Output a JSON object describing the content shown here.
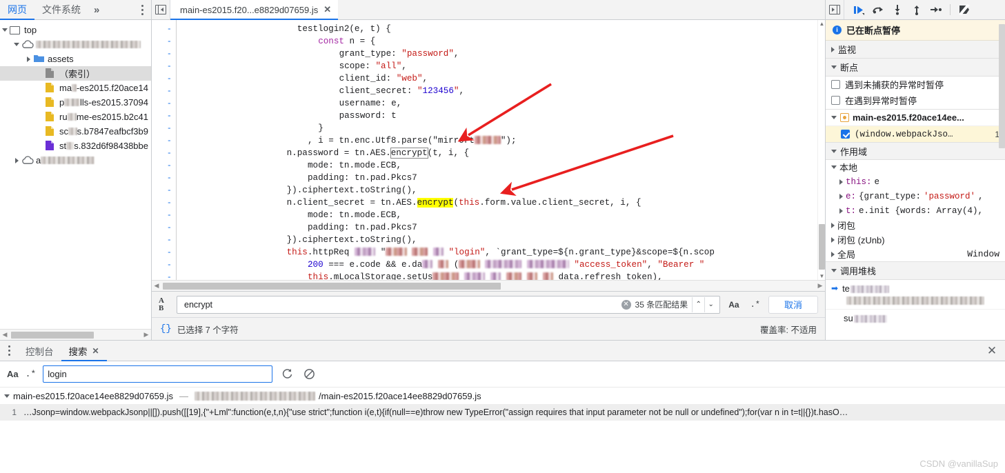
{
  "navigator": {
    "tabs": [
      {
        "label": "网页",
        "selected": true,
        "name": "tab-page"
      },
      {
        "label": "文件系统",
        "selected": false,
        "name": "tab-filesystem"
      }
    ],
    "more_label": "»",
    "tree": [
      {
        "depth": 0,
        "twisty": "open",
        "icon": "frame-icon",
        "label": "top",
        "redacted": false,
        "selected": false
      },
      {
        "depth": 1,
        "twisty": "open",
        "icon": "cloud-icon",
        "label": "",
        "redacted": true,
        "redact_width": 152,
        "selected": false
      },
      {
        "depth": 2,
        "twisty": "closed",
        "icon": "folder-icon",
        "label": "assets",
        "redacted": false,
        "selected": false
      },
      {
        "depth": 3,
        "twisty": "none",
        "icon": "doc-gray-icon",
        "label": "（索引）",
        "redacted": false,
        "selected": true
      },
      {
        "depth": 3,
        "twisty": "none",
        "icon": "doc-yellow-icon",
        "label": "ma",
        "label_tail": "-es2015.f20ace14",
        "redacted": true,
        "redact_width": 18,
        "selected": false
      },
      {
        "depth": 3,
        "twisty": "none",
        "icon": "doc-yellow-icon",
        "label": "p",
        "label_tail": "lls-es2015.37094",
        "redacted": true,
        "redact_width": 24,
        "selected": false
      },
      {
        "depth": 3,
        "twisty": "none",
        "icon": "doc-yellow-icon",
        "label": "ru",
        "label_tail": "me-es2015.b2c41",
        "redacted": true,
        "redact_width": 22,
        "selected": false
      },
      {
        "depth": 3,
        "twisty": "none",
        "icon": "doc-yellow-icon",
        "label": "sc",
        "label_tail": "s.b7847eafbcf3b9",
        "redacted": true,
        "redact_width": 22,
        "selected": false
      },
      {
        "depth": 3,
        "twisty": "none",
        "icon": "doc-purple-icon",
        "label": "st",
        "label_tail": "s.832d6f98438bbe",
        "redacted": true,
        "redact_width": 20,
        "selected": false
      },
      {
        "depth": 1,
        "twisty": "closed",
        "icon": "cloud-icon",
        "label": "a",
        "redacted": true,
        "redact_width": 78,
        "selected": false
      }
    ]
  },
  "editor": {
    "tab": {
      "title": "main-es2015.f20...e8829d07659.js",
      "close": "✕"
    },
    "gutter_marks": [
      "-",
      "-",
      "-",
      "-",
      "-",
      "-",
      "-",
      "-",
      "-",
      "-",
      "-",
      "-",
      "-",
      "-",
      "-",
      "-",
      "-",
      "-",
      "-",
      "-",
      "-"
    ],
    "code_lines": [
      "testlogin2(e, t) {",
      "const n = {",
      "grant_type: \"password\",",
      "scope: \"all\",",
      "client_id: \"web\",",
      "client_secret: \"123456\",",
      "username: e,",
      "password: t",
      "}",
      ", i = tn.enc.Utf8.parse(\"mirrort█████\");",
      "n.password = tn.AES.encrypt(t, i, {",
      "mode: tn.mode.ECB,",
      "padding: tn.pad.Pkcs7",
      "}).ciphertext.toString(),",
      "n.client_secret = tn.AES.encrypt(this.form.value.client_secret, i, {",
      "mode: tn.mode.ECB,",
      "padding: tn.pad.Pkcs7",
      "}).ciphertext.toString(),",
      "this.httpReq ████ \"████ ███ ██ \"login\", `grant_type=${n.grant_type}&scope=${n.scop",
      "200 === e.code && e.da██ ██ (████ ███████ ████████ \"access_token\", \"Bearer \"",
      "this.mLocalStorage.setUs█████ ████ ██ ███ ██ ██ data.refresh token),"
    ]
  },
  "findbar": {
    "case_icon_top": "A",
    "case_icon_bottom": "B",
    "query": "encrypt",
    "placeholder": "",
    "match_count": "35 条匹配结果",
    "prev_label": "⌃",
    "next_label": "⌄",
    "match_case_label": "Aa",
    "regex_label": ".*",
    "cancel_label": "取消"
  },
  "statusbar": {
    "pretty_print_icon": "{}",
    "selection_text": "已选择 7 个字符",
    "coverage_text": "覆盖率: 不适用"
  },
  "debugger": {
    "toolbar_icons": [
      "resume-icon",
      "step-over-icon",
      "step-into-icon",
      "step-out-icon",
      "step-icon",
      "deactivate-breakpoints-icon"
    ],
    "paused_banner": "已在断点暂停",
    "sections": {
      "watch": "监视",
      "breakpoints": "断点",
      "scope": "作用域",
      "callstack": "调用堆栈"
    },
    "breakpoint_options": [
      {
        "label": "遇到未捕获的异常时暂停",
        "checked": false
      },
      {
        "label": "在遇到异常时暂停",
        "checked": false
      }
    ],
    "breakpoint_file": "main-es2015.f20ace14ee...",
    "breakpoint_entry": {
      "label": "(window.webpackJso…",
      "line": "1",
      "checked": true
    },
    "scope_local_label": "本地",
    "scope_rows": [
      {
        "key": "this:",
        "val": " e",
        "mono": true
      },
      {
        "key": "e:",
        "val": " {grant_type: ",
        "str": "'password'",
        "tail": ",",
        "mono": true
      },
      {
        "key": "t:",
        "val": " e.init {words: Array(4),",
        "mono": true
      }
    ],
    "scope_groups": [
      {
        "label": "闭包",
        "right": ""
      },
      {
        "label": "闭包 (zUnb)",
        "right": ""
      },
      {
        "label": "全局",
        "right": "Window"
      }
    ],
    "callstack": [
      {
        "fn": "te",
        "fn_redacted": true,
        "file": "main-es2015.f20ace14ee8829d07659.js:1",
        "file_redacted": true,
        "active": true
      },
      {
        "fn": "sub",
        "fn_redacted": true,
        "file": "",
        "file_redacted": true,
        "active": false
      }
    ]
  },
  "drawer": {
    "tabs": [
      {
        "label": "控制台",
        "selected": false,
        "closable": false
      },
      {
        "label": "搜索",
        "selected": true,
        "closable": true,
        "close": "✕"
      }
    ],
    "close_label": "✕",
    "toolbar": {
      "match_case_label": "Aa",
      "regex_label": ".*",
      "query": "login",
      "placeholder": "",
      "refresh_icon": "refresh-icon",
      "clear_icon": "clear-icon"
    },
    "results": {
      "file_name": "main-es2015.f20ace14ee8829d07659.js",
      "separator": "—",
      "path_suffix": "/main-es2015.f20ace14ee8829d07659.js",
      "line_number": "1",
      "line_text": "…Jsonp=window.webpackJsonp||[]).push([[19],{\"+Lml\":function(e,t,n){\"use strict\";function i(e,t){if(null==e)throw new TypeError(\"assign requires that input parameter not be null or undefined\");for(var n in t=t||{})t.hasO…"
    }
  },
  "watermark": "CSDN @vanillaSup",
  "colors": {
    "accent": "#1a73e8",
    "highlight": "#ffff00",
    "paused_bg": "#fdf6e3",
    "breakpoint_bg": "#fdf6d8",
    "annotation_arrow": "#e81f1f"
  }
}
